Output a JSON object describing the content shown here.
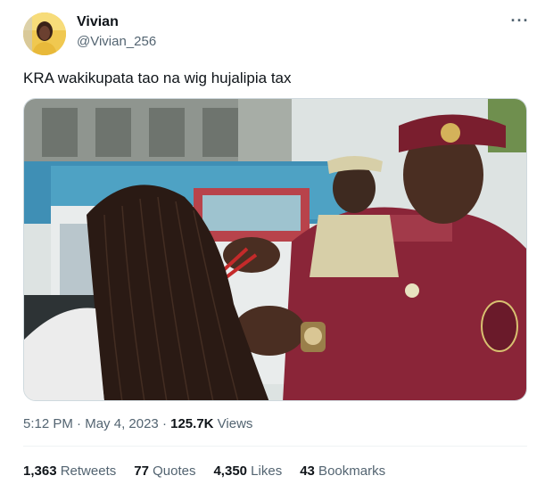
{
  "user": {
    "display_name": "Vivian",
    "handle": "@Vivian_256"
  },
  "more_label": "···",
  "tweet": {
    "text": "KRA wakikupata tao na wig hujalipia tax"
  },
  "meta": {
    "time": "5:12 PM",
    "dot1": " · ",
    "date": "May 4, 2023",
    "dot2": " · ",
    "views_count": "125.7K",
    "views_label": " Views"
  },
  "stats": [
    {
      "count": "1,363",
      "label": " Retweets"
    },
    {
      "count": "77",
      "label": " Quotes"
    },
    {
      "count": "4,350",
      "label": " Likes"
    },
    {
      "count": "43",
      "label": " Bookmarks"
    }
  ],
  "colors": {
    "text_primary": "#0f1419",
    "text_secondary": "#536471",
    "divider": "#eff3f4",
    "uniform_maroon": "#8a2538"
  },
  "icons": {
    "more": "more-horizontal-icon"
  }
}
